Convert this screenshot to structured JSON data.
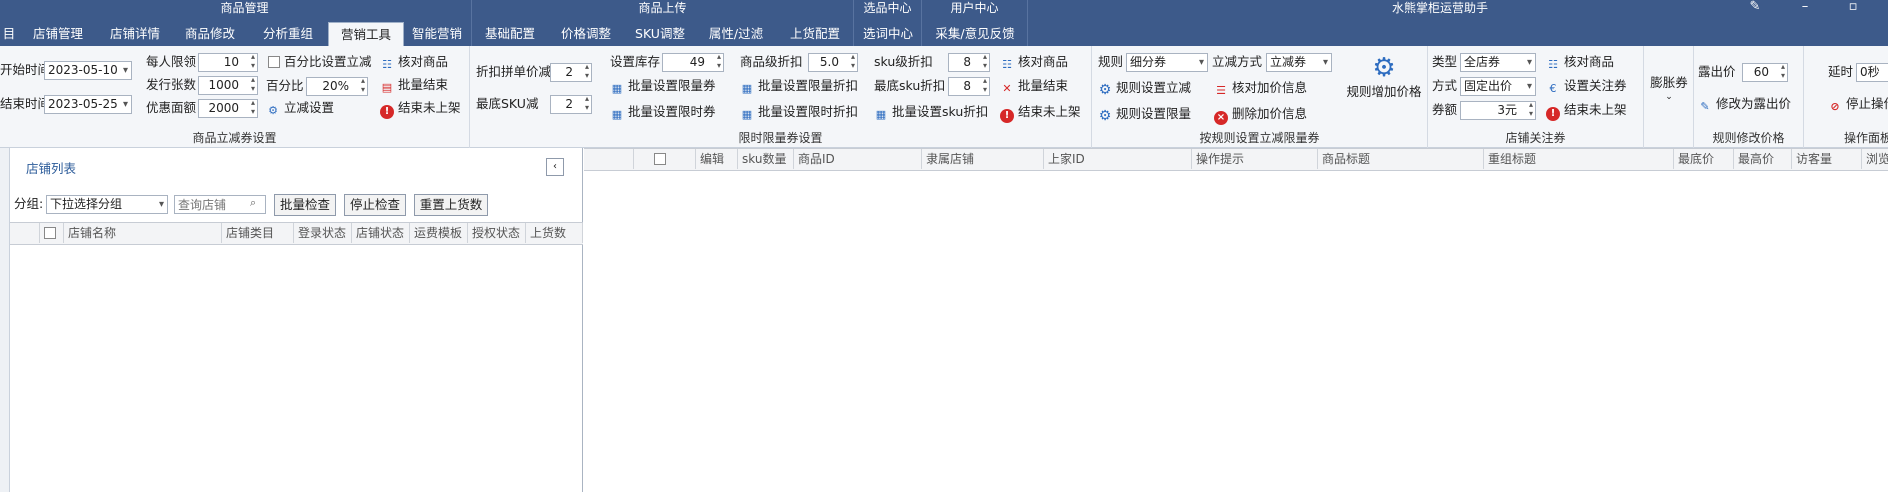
{
  "titlebar": {
    "left_menu": "目",
    "app_title": "水熊掌柜运营助手",
    "groups": [
      {
        "title": "商品管理",
        "tabs": [
          "店铺管理",
          "店铺详情",
          "商品修改",
          "分析重组",
          "营销工具",
          "智能营销"
        ]
      },
      {
        "title": "商品上传",
        "tabs": [
          "基础配置",
          "价格调整",
          "SKU调整",
          "属性/过滤",
          "上货配置"
        ]
      },
      {
        "title": "选品中心",
        "tabs": [
          "选词中心"
        ]
      },
      {
        "title": "用户中心",
        "tabs": [
          "采集/意见反馈"
        ]
      }
    ],
    "active_tab": "营销工具"
  },
  "ribbon": {
    "coupon": {
      "start_label": "开始时间",
      "start_value": "2023-05-10",
      "end_label": "结束时间",
      "end_value": "2023-05-25",
      "limit_label": "每人限领",
      "limit_value": "10",
      "issue_label": "发行张数",
      "issue_value": "1000",
      "discount_label": "优惠面额",
      "discount_value": "2000",
      "pct_check_label": "百分比设置立减",
      "pct_label": "百分比",
      "pct_value": "20%",
      "set_btn": "立减设置",
      "check_btn": "核对商品",
      "batch_end_btn": "批量结束",
      "end_unlisted_btn": "结束未上架",
      "group_label": "商品立减券设置"
    },
    "limited": {
      "fold_label": "折扣拼单价减",
      "fold_value": "2",
      "minsku_label": "最底SKU减",
      "minsku_value": "2",
      "stock_label": "设置库存",
      "stock_value": "49",
      "batch_limit_btn": "批量设置限量券",
      "batch_time_btn": "批量设置限时券",
      "item_disc_label": "商品级折扣",
      "item_disc_value": "5.0",
      "batch_limit_disc_btn": "批量设置限量折扣",
      "batch_time_disc_btn": "批量设置限时折扣",
      "sku_disc_label": "sku级折扣",
      "sku_disc_value": "8",
      "min_sku_disc_label": "最底sku折扣",
      "min_sku_disc_value": "8",
      "batch_sku_btn": "批量设置sku折扣",
      "check_btn": "核对商品",
      "batch_end_btn": "批量结束",
      "end_unlisted_btn": "结束未上架",
      "group_label": "限时限量券设置"
    },
    "rule": {
      "rule_label": "规则",
      "rule_value": "细分券",
      "mode_label": "立减方式",
      "mode_value": "立减券",
      "rule_set_btn": "规则设置立减",
      "rule_limit_btn": "规则设置限量",
      "check_price_btn": "核对加价信息",
      "del_price_btn": "删除加价信息",
      "rule_add_btn": "规则增加价格",
      "group_label": "按规则设置立减限量券"
    },
    "follow": {
      "type_label": "类型",
      "type_value": "全店券",
      "method_label": "方式",
      "method_value": "固定出价",
      "amount_label": "券额",
      "amount_value": "3元",
      "check_btn": "核对商品",
      "set_follow_btn": "设置关注券",
      "end_unlisted_btn": "结束未上架",
      "group_label": "店铺关注券"
    },
    "swell": {
      "label": "膨胀券"
    },
    "expose": {
      "price_label": "露出价",
      "price_value": "60",
      "modify_btn": "修改为露出价",
      "group_label": "规则修改价格"
    },
    "op": {
      "delay_label": "延时",
      "delay_value": "0秒",
      "stop_btn": "停止操作",
      "group_label": "操作面板"
    }
  },
  "left_panel": {
    "title": "店铺列表",
    "group_label": "分组:",
    "group_select": "下拉选择分组",
    "search_placeholder": "查询店铺",
    "buttons": [
      "批量检查",
      "停止检查",
      "重置上货数"
    ],
    "columns": [
      "店铺名称",
      "店铺类目",
      "登录状态",
      "店铺状态",
      "运费模板",
      "授权状态",
      "上货数"
    ]
  },
  "grid": {
    "columns": [
      "编辑",
      "sku数量",
      "商品ID",
      "隶属店铺",
      "上家ID",
      "操作提示",
      "商品标题",
      "重组标题",
      "最底价",
      "最高价",
      "访客量",
      "浏览"
    ]
  }
}
